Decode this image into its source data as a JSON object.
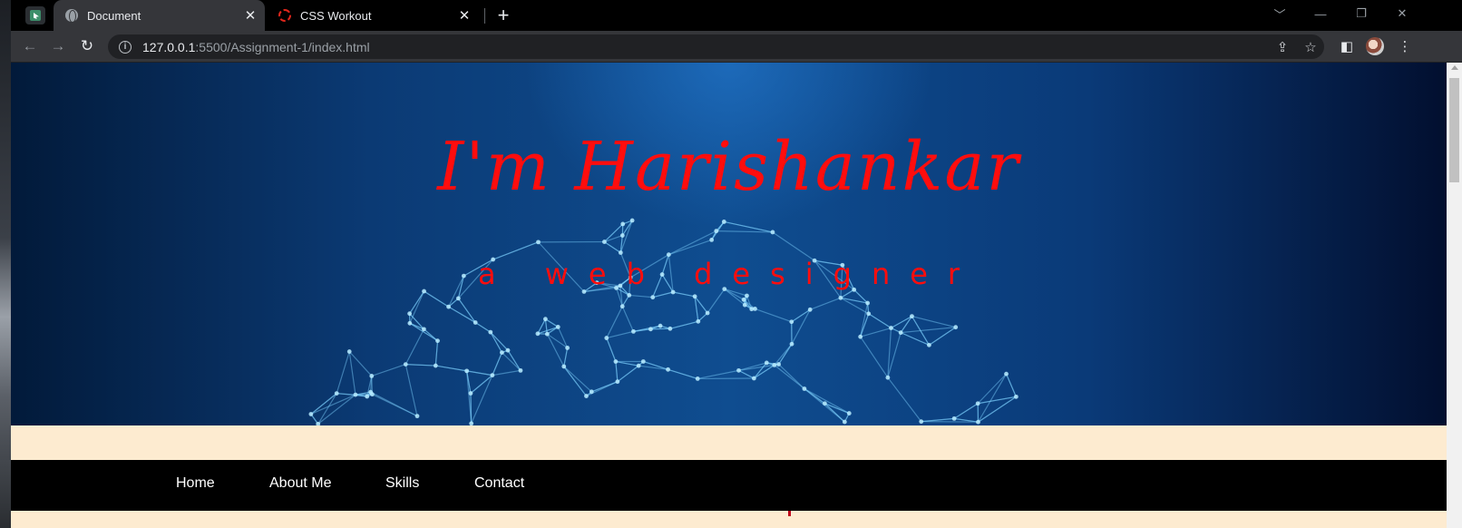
{
  "browser": {
    "tabs": [
      {
        "title": "Document",
        "active": true,
        "favicon": "globe-icon"
      },
      {
        "title": "CSS Workout",
        "active": false,
        "favicon": "dashed-ring-icon"
      }
    ],
    "new_tab_glyph": "+",
    "address": {
      "host": "127.0.0.1",
      "rest": ":5500/Assignment-1/index.html"
    },
    "icons": {
      "back": "back-arrow-icon",
      "forward": "forward-arrow-icon",
      "reload": "reload-icon",
      "share": "share-icon",
      "bookmark": "star-icon",
      "sidepanel": "side-panel-icon",
      "profile": "avatar",
      "menu": "kebab-menu-icon"
    }
  },
  "page": {
    "hero": {
      "title": "I'm Harishankar",
      "subtitle": "a web designer"
    },
    "nav": [
      {
        "label": "Home"
      },
      {
        "label": "About Me"
      },
      {
        "label": "Skills"
      },
      {
        "label": "Contact"
      }
    ]
  },
  "colors": {
    "hero_text": "#ff0d0d",
    "beige": "#fdebd0",
    "navbar": "#000000",
    "nav_text": "#ffffff"
  }
}
